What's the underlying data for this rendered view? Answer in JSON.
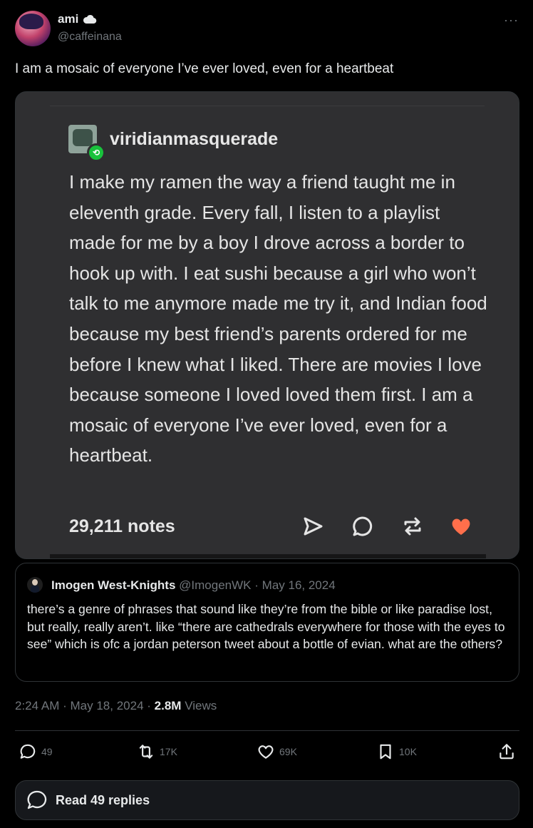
{
  "author": {
    "display_name": "ami",
    "handle": "@caffeinana",
    "badge_icon": "cloud-icon"
  },
  "tweet": {
    "text": "I am a mosaic of everyone I’ve ever loved, even for a heartbeat"
  },
  "media": {
    "username": "viridianmasquerade",
    "body": "I make my ramen the way a friend taught me in eleventh grade. Every fall, I listen to a playlist made for me by a boy I drove across a border to hook up with. I eat sushi because a girl who won’t talk to me anymore made me try it, and Indian food because my best friend’s parents ordered for me before I knew what I liked. There are movies I love because someone I loved loved them first. I am a mosaic of everyone I’ve ever loved, even for a heartbeat.",
    "notes": "29,211 notes",
    "icons": [
      "send-icon",
      "comment-icon",
      "reblog-icon",
      "heart-icon"
    ],
    "heart_color": "#ff6f4b",
    "reblog_badge_color": "#18c23c"
  },
  "quote": {
    "name": "Imogen West-Knights",
    "handle": "@ImogenWK",
    "separator": "·",
    "date": "May 16, 2024",
    "text": "there’s a genre of phrases that sound like they’re from the bible or like paradise lost, but really, really aren’t. like “there are cathedrals everywhere for those with the eyes to see” which is ofc a jordan peterson tweet about a bottle of evian. what are the others?"
  },
  "meta": {
    "time": "2:24 AM",
    "date": "May 18, 2024",
    "views_count": "2.8M",
    "views_label": "Views"
  },
  "actions": {
    "replies": "49",
    "reposts": "17K",
    "likes": "69K",
    "bookmarks": "10K"
  },
  "replies_button": {
    "label": "Read 49 replies"
  }
}
